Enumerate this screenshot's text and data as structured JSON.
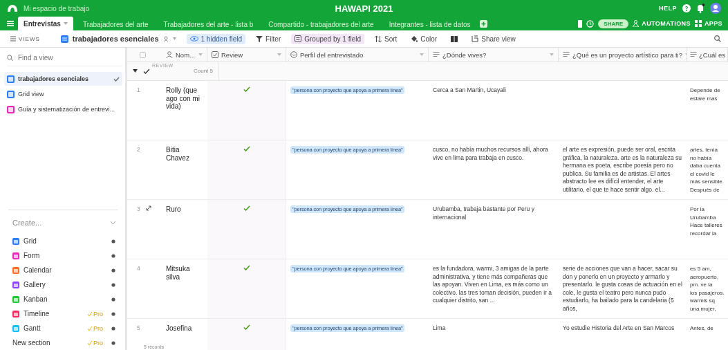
{
  "top_bar": {
    "workspace": "Mi espacio de trabajo",
    "title": "HAWAPI 2021",
    "help": "HELP"
  },
  "tabs": [
    {
      "label": "Entrevistas",
      "selected": true
    },
    {
      "label": "Trabajadores del arte",
      "selected": false
    },
    {
      "label": "Trabajadores del arte - lista b",
      "selected": false
    },
    {
      "label": "Compartido - trabajadores del arte",
      "selected": false
    },
    {
      "label": "Integrantes - lista de datos",
      "selected": false
    }
  ],
  "tab_actions": {
    "share": "SHARE",
    "automations": "AUTOMATIONS",
    "apps": "APPS"
  },
  "toolbar": {
    "views": "VIEWS",
    "current_view": "trabajadores esenciales",
    "items": [
      {
        "kind": "hidden",
        "label": "1 hidden field"
      },
      {
        "kind": "filter",
        "label": "Filter"
      },
      {
        "kind": "group",
        "label": "Grouped by 1 field"
      },
      {
        "kind": "sort",
        "label": "Sort"
      },
      {
        "kind": "color",
        "label": "Color"
      },
      {
        "kind": "height"
      },
      {
        "kind": "share",
        "label": "Share view"
      }
    ]
  },
  "sidebar": {
    "search": {
      "placeholder": "Find a view"
    },
    "views": [
      {
        "name": "trabajadores esenciales",
        "color": "#2d7ff9",
        "selected": true
      },
      {
        "name": "Grid view",
        "color": "#2d7ff9",
        "selected": false
      },
      {
        "name": "Guía y sistematización de entrevi...",
        "color": "#e929ba",
        "selected": false
      }
    ],
    "create_title": "Create...",
    "create_items": [
      {
        "name": "Grid",
        "color": "#2d7ff9"
      },
      {
        "name": "Form",
        "color": "#e929ba"
      },
      {
        "name": "Calendar",
        "color": "#ff6f2c"
      },
      {
        "name": "Gallery",
        "color": "#8b46ff"
      },
      {
        "name": "Kanban",
        "color": "#20c933"
      },
      {
        "name": "Timeline",
        "color": "#f82b60",
        "badge": "Pro"
      },
      {
        "name": "Gantt",
        "color": "#18bfff",
        "badge": "Pro"
      },
      {
        "name": "New section",
        "badge": "Pro"
      }
    ]
  },
  "table": {
    "columns": [
      {
        "kind": "user",
        "label": "Nom..."
      },
      {
        "kind": "checkbox",
        "label": "Review"
      },
      {
        "kind": "select",
        "label": "Perfil del entrevistado"
      },
      {
        "kind": "long_text",
        "label": "¿Dónde vives?"
      },
      {
        "kind": "long_text",
        "label": "¿Qué es un proyecto artístico para ti?"
      },
      {
        "kind": "long_text",
        "label": "¿Cuál es"
      }
    ],
    "group": {
      "field": "REVIEW",
      "checked": true,
      "count": "Count 5"
    },
    "rows": [
      {
        "number": "1",
        "name": "Rolly (que ago con mi vida)",
        "review": true,
        "profile": "\"persona con proyecto que apoya a primera línea\"",
        "lives": "Cerca a San Martin, Ucayali",
        "column_6": [
          "Depende de",
          "estare mas"
        ]
      },
      {
        "number": "2",
        "name": "Bitia Chavez",
        "review": true,
        "profile": "\"persona con proyecto que apoya a primera línea\"",
        "lives": "cusco, no había muchos recursos allí, ahora vive en lima para trabaja en cusco.",
        "project": "el arte es expresión, puede ser oral, escrita gráfica, la naturaleza. arte es la naturaleza su hermana es poeta, escribe poesía pero no publica. Su familia es de artistas. El artes abstracto lee es difícil entender, el arte utilitario, el que te hace sentir algo. el...",
        "column_6": [
          "artes, tenía",
          "no había",
          "daba cuenta",
          "el covid le",
          "más sensible.",
          "Después de"
        ]
      },
      {
        "number": "3",
        "name": "Ruro",
        "review": true,
        "profile": "\"persona con proyecto que apoya a primera línea\"",
        "lives": "Urubamba, trabaja bastante por Peru y internacional",
        "column_6": [
          "Por la",
          "Urubamba",
          "Hace talleres",
          "recordar la"
        ]
      },
      {
        "number": "4",
        "name": "Mitsuka silva",
        "review": true,
        "profile": "\"persona con proyecto que apoya a primera línea\"",
        "lives": "es la fundadora, warmi, 3 amigas de la parte administrativa, y tiene más compañeras que las apoyan. Viven en Lima, es más como un colectivo. las tres toman decisión, pueden ir a cualquier distrito, san ...",
        "project": "serie de acciones que van a hacer, sacar su don y ponerlo en un proyecto y armarlo y presentarlo. le gusta cosas de actuación en el cole, le gusta el teatro pero nunca pudo estudiarlo, ha bailado para la candelaria (5 años,",
        "column_6": [
          "es 5 am,",
          "aeropuerto,",
          "pm. ve la",
          "los pasajeros.",
          "warmis sq",
          "una mujer,"
        ]
      },
      {
        "number": "5",
        "name": "Josefina",
        "review": true,
        "profile": "\"persona con proyecto que apoya a primera línea\"",
        "lives": "Lima",
        "project": "Yo estudie Historia del Arte en San Marcos",
        "column_6": [
          "Antes, de"
        ]
      }
    ],
    "footer": "5 records"
  }
}
